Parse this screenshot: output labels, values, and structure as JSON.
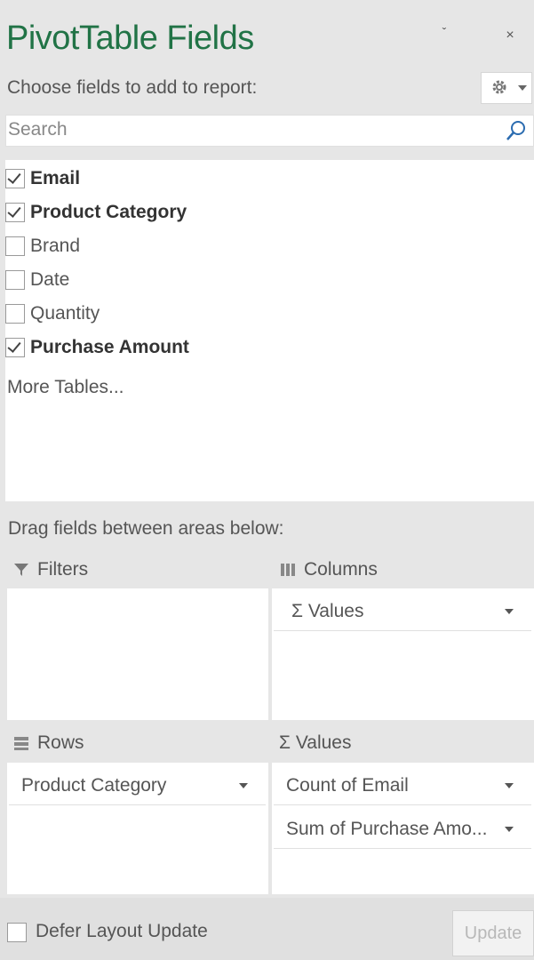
{
  "pane": {
    "title": "PivotTable Fields",
    "subtitle": "Choose fields to add to report:",
    "pin_icon": "ˇ",
    "close_icon": "×"
  },
  "search": {
    "placeholder": "Search"
  },
  "fields": [
    {
      "label": "Email",
      "checked": true
    },
    {
      "label": "Product Category",
      "checked": true
    },
    {
      "label": "Brand",
      "checked": false
    },
    {
      "label": "Date",
      "checked": false
    },
    {
      "label": "Quantity",
      "checked": false
    },
    {
      "label": "Purchase Amount",
      "checked": true
    }
  ],
  "more_tables": "More Tables...",
  "drag_hint": "Drag fields between areas below:",
  "areas": {
    "filters": {
      "label": "Filters",
      "icon": "filter-icon",
      "items": []
    },
    "columns": {
      "label": "Columns",
      "icon": "columns-icon",
      "items": [
        "Σ Values"
      ]
    },
    "rows": {
      "label": "Rows",
      "icon": "rows-icon",
      "items": [
        "Product Category"
      ]
    },
    "values": {
      "label": "Σ Values",
      "icon": "sigma-icon",
      "items": [
        "Count of Email",
        "Sum of Purchase Amo..."
      ]
    }
  },
  "footer": {
    "defer_label": "Defer Layout Update",
    "defer_checked": false,
    "update_label": "Update"
  },
  "colors": {
    "title": "#217346",
    "background": "#e6e6e6"
  }
}
